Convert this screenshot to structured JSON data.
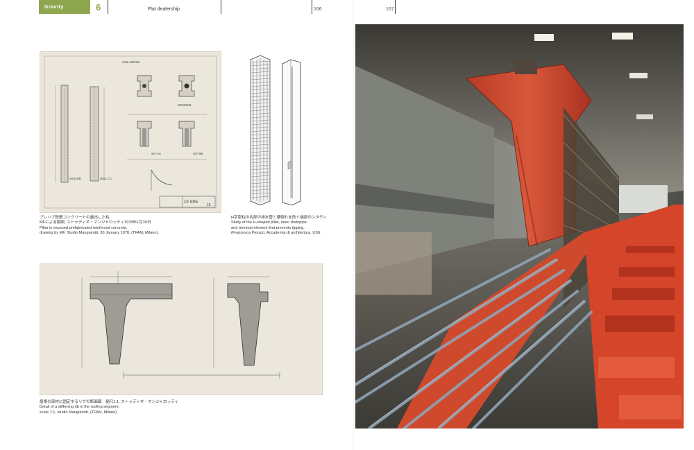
{
  "header": {
    "section_label": "Gravity",
    "section_number": "6",
    "running_title": "Flat dealership",
    "left_page_number": "166",
    "right_page_number": "167"
  },
  "figure1": {
    "labels": {
      "top": "vista dall'alto",
      "section": "SEZIONE",
      "sez_aa": "sez AA",
      "sez_bb": "sez BB",
      "vista_bb": "vista BB",
      "vista_cc": "vista CC",
      "title_block": "10 SPE",
      "sheet": "15"
    },
    "caption_jp": "プレハブ鉄筋コンクリートの露出した柱",
    "caption_jp2": "MFによる製図, ストゥディオ・マンジャロッティ1978年1月30日",
    "caption_en1": "Pillar in exposed prefabricated reinforced concrete,",
    "caption_en2": "drawing by MF, Studio Mangiarotti, 30 January 1978. (TFAM, Milano)."
  },
  "figure2": {
    "caption_jp": "H字型柱の内部の排水管と横倒れを防ぐ端部のスタディ",
    "caption_en1": "Study of the H-shaped pillar, inner drainpipe",
    "caption_en2": "and terminal element that prevents tipping.",
    "caption_en3": "(Francesca Peruzzi, Accademia di architettura, USI)."
  },
  "figure3": {
    "caption_jp": "屋根の部材に固定するリブの断面図　縮尺1:1, ストゥディオ・マンジャロッティ",
    "caption_en1": "Detail of a stiffening rib in the roofing segment,",
    "caption_en2": "scale 1:1, studio Mangiarotti. (TFAM, Milano)."
  },
  "colors": {
    "accent": "#8ea74f",
    "paper": "#ebe7dc",
    "concrete_red": "#d2472c",
    "factory_gray": "#7d8079"
  }
}
